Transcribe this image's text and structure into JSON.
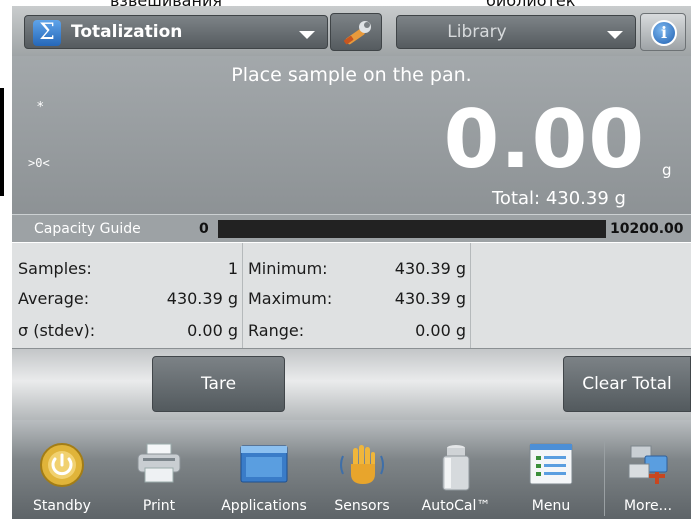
{
  "overlay": {
    "left_caption": "взвешивания",
    "right_caption": "библиотек"
  },
  "topbar": {
    "mode_label": "Totalization",
    "mode_icon": "sigma-icon",
    "settings_icon": "wrench-icon",
    "library_label": "Library",
    "info_icon": "info-icon"
  },
  "display": {
    "prompt": "Place sample on the pan.",
    "stability_indicator": "*",
    "zero_indicator": ">0<",
    "weight": "0.00",
    "unit": "g",
    "total": "Total: 430.39 g"
  },
  "capacity_guide": {
    "label": "Capacity Guide",
    "min": "0",
    "max": "10200.00"
  },
  "stats": {
    "samples_label": "Samples:",
    "samples_value": "1",
    "average_label": "Average:",
    "average_value": "430.39 g",
    "stdev_label": "σ (stdev):",
    "stdev_value": "0.00 g",
    "minimum_label": "Minimum:",
    "minimum_value": "430.39 g",
    "maximum_label": "Maximum:",
    "maximum_value": "430.39 g",
    "range_label": "Range:",
    "range_value": "0.00 g"
  },
  "actions": {
    "tare": "Tare",
    "clear_total": "Clear Total"
  },
  "nav": {
    "standby": "Standby",
    "print": "Print",
    "applications": "Applications",
    "sensors": "Sensors",
    "autocal": "AutoCal™",
    "menu": "Menu",
    "more": "More..."
  },
  "colors": {
    "screen_bg": "#9ea3a6",
    "accent_blue": "#2567b8",
    "standby_gold": "#e0b43a"
  }
}
